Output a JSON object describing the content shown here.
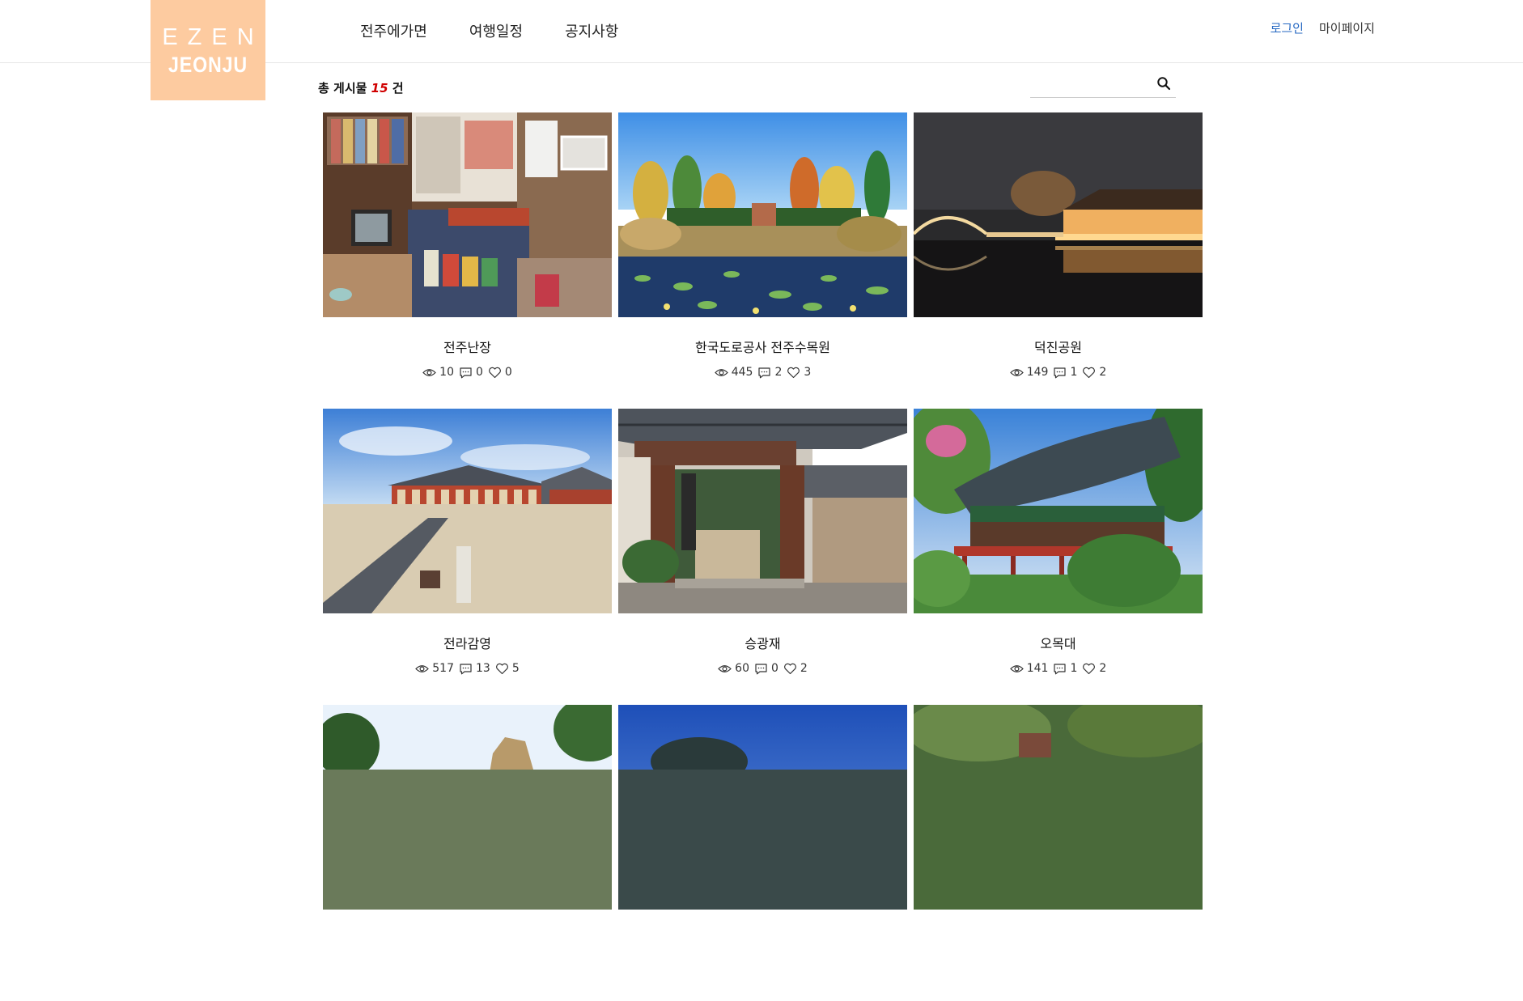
{
  "logo": {
    "line1": "EZEN",
    "line2": "JEONJU"
  },
  "nav": {
    "items": [
      "전주에가면",
      "여행일정",
      "공지사항"
    ]
  },
  "util": {
    "login": "로그인",
    "mypage": "마이페이지"
  },
  "count": {
    "prefix": "총 게시물",
    "number": "15",
    "suffix": "건"
  },
  "search": {
    "placeholder": "",
    "icon": "search-icon"
  },
  "posts": [
    {
      "title": "전주난장",
      "views": "10",
      "comments": "0",
      "likes": "0"
    },
    {
      "title": "한국도로공사 전주수목원",
      "views": "445",
      "comments": "2",
      "likes": "3"
    },
    {
      "title": "덕진공원",
      "views": "149",
      "comments": "1",
      "likes": "2"
    },
    {
      "title": "전라감영",
      "views": "517",
      "comments": "13",
      "likes": "5"
    },
    {
      "title": "승광재",
      "views": "60",
      "comments": "0",
      "likes": "2"
    },
    {
      "title": "오목대",
      "views": "141",
      "comments": "1",
      "likes": "2"
    },
    {
      "title": "",
      "views": "",
      "comments": "",
      "likes": ""
    },
    {
      "title": "",
      "views": "",
      "comments": "",
      "likes": ""
    },
    {
      "title": "",
      "views": "",
      "comments": "",
      "likes": ""
    }
  ],
  "colors": {
    "logo_bg": "#fdcba0",
    "login": "#2467c2",
    "count_num": "#d00000"
  }
}
